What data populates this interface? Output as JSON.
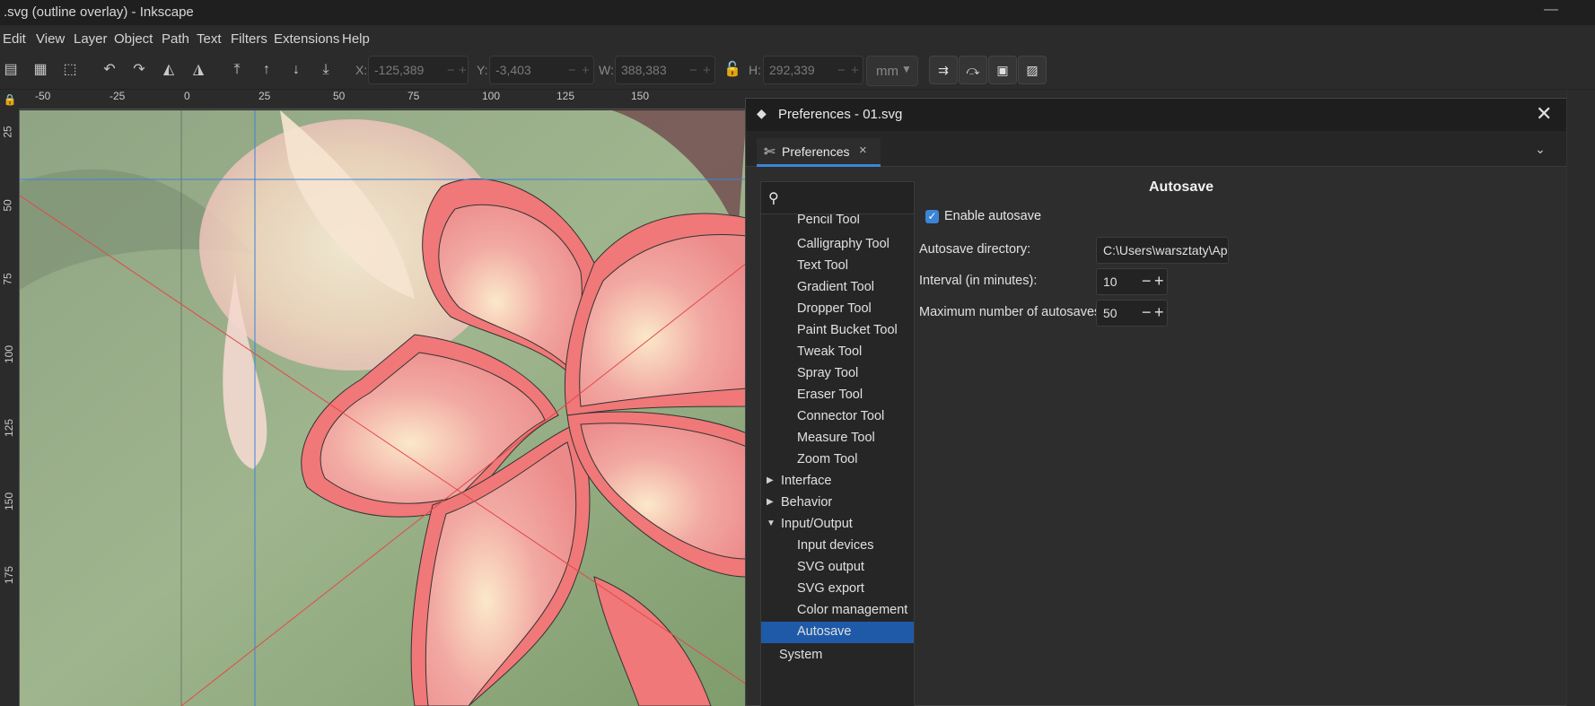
{
  "window": {
    "title": ".svg (outline overlay) - Inkscape",
    "minimize_icon": "minimize-icon"
  },
  "menu": [
    "Edit",
    "View",
    "Layer",
    "Object",
    "Path",
    "Text",
    "Filters",
    "Extensions",
    "Help"
  ],
  "toolbar": {
    "x_label": "X:",
    "x_value": "-125,389",
    "y_label": "Y:",
    "y_value": "-3,403",
    "w_label": "W:",
    "w_value": "388,383",
    "h_label": "H:",
    "h_value": "292,339",
    "unit": "mm"
  },
  "ruler": {
    "h_labels": [
      "-50",
      "-25",
      "0",
      "25",
      "50",
      "75",
      "100",
      "125",
      "150"
    ],
    "v_labels": [
      "25",
      "50",
      "75",
      "100",
      "125",
      "150",
      "175"
    ]
  },
  "dialog": {
    "title": "Preferences - 01.svg",
    "tab_label": "Preferences",
    "tree": {
      "tool_items": [
        "Pencil Tool",
        "Calligraphy Tool",
        "Text Tool",
        "Gradient Tool",
        "Dropper Tool",
        "Paint Bucket Tool",
        "Tweak Tool",
        "Spray Tool",
        "Eraser Tool",
        "Connector Tool",
        "Measure Tool",
        "Zoom Tool"
      ],
      "interface": "Interface",
      "behavior": "Behavior",
      "input_output": "Input/Output",
      "io_items": [
        "Input devices",
        "SVG output",
        "SVG export",
        "Color management",
        "Autosave"
      ],
      "system": "System"
    },
    "autosave": {
      "heading": "Autosave",
      "enable_label": "Enable autosave",
      "enabled": true,
      "directory_label": "Autosave directory:",
      "directory_value": "C:\\Users\\warsztaty\\AppData",
      "interval_label": "Interval (in minutes):",
      "interval_value": "10",
      "max_label": "Maximum number of autosaves:",
      "max_value": "50"
    }
  },
  "colors": {
    "accent": "#3c84d6",
    "selection": "#1f5aa8",
    "outline": "#f07070"
  }
}
